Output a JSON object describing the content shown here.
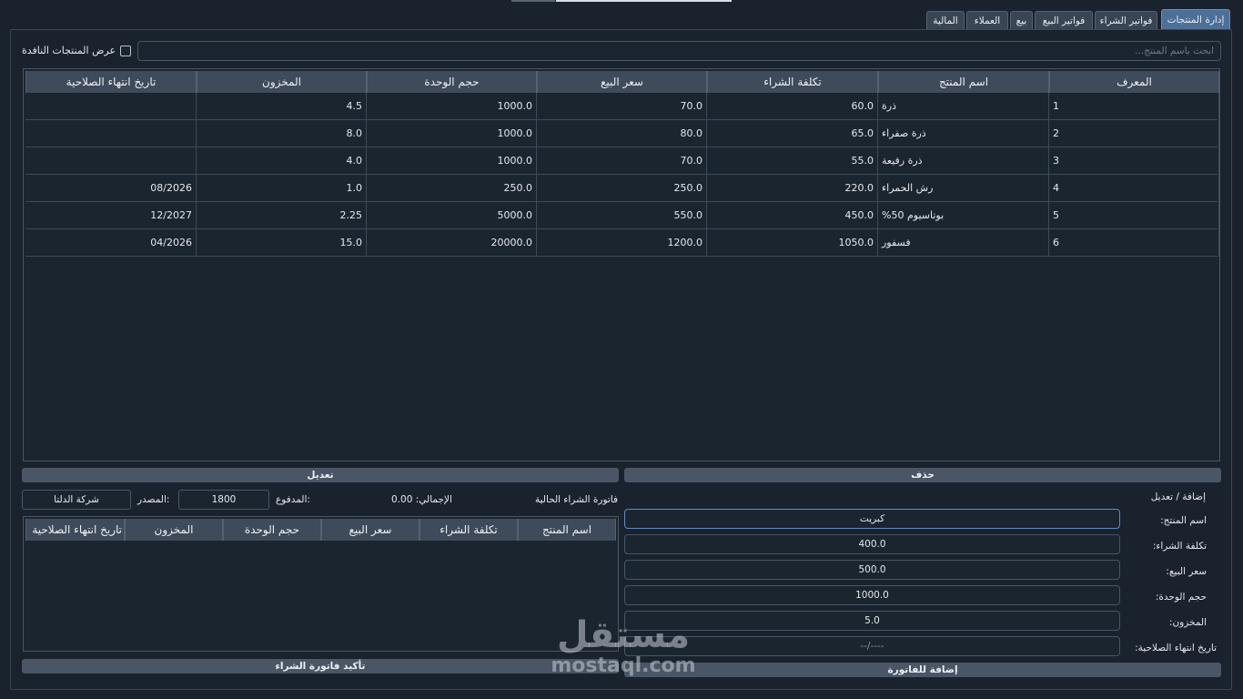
{
  "tabs": [
    {
      "label": "إدارة المنتجات",
      "active": true
    },
    {
      "label": "فواتير الشراء",
      "active": false
    },
    {
      "label": "فواتير البيع",
      "active": false
    },
    {
      "label": "بيع",
      "active": false
    },
    {
      "label": "العملاء",
      "active": false
    },
    {
      "label": "المالية",
      "active": false
    }
  ],
  "search": {
    "placeholder": "ابحث باسم المنتج..."
  },
  "expired_filter": {
    "label": "عرض المنتجات النافدة",
    "checked": false
  },
  "products_table": {
    "headers": [
      "المعرف",
      "اسم المنتج",
      "تكلفة الشراء",
      "سعر البيع",
      "حجم الوحدة",
      "المخزون",
      "تاريخ انتهاء الصلاحية"
    ],
    "rows": [
      {
        "id": "1",
        "name": "ذرة",
        "cost": "60.0",
        "price": "70.0",
        "unit": "1000.0",
        "stock": "4.5",
        "expiry": ""
      },
      {
        "id": "2",
        "name": "ذرة صفراء",
        "cost": "65.0",
        "price": "80.0",
        "unit": "1000.0",
        "stock": "8.0",
        "expiry": ""
      },
      {
        "id": "3",
        "name": "ذرة رفيعة",
        "cost": "55.0",
        "price": "70.0",
        "unit": "1000.0",
        "stock": "4.0",
        "expiry": ""
      },
      {
        "id": "4",
        "name": "رش الحمراء",
        "cost": "220.0",
        "price": "250.0",
        "unit": "250.0",
        "stock": "1.0",
        "expiry": "08/2026"
      },
      {
        "id": "5",
        "name": "بوتاسيوم 50%",
        "cost": "450.0",
        "price": "550.0",
        "unit": "5000.0",
        "stock": "2.25",
        "expiry": "12/2027"
      },
      {
        "id": "6",
        "name": "فسفور",
        "cost": "1050.0",
        "price": "1200.0",
        "unit": "20000.0",
        "stock": "15.0",
        "expiry": "04/2026"
      }
    ]
  },
  "actions": {
    "edit_label": "تعديل",
    "delete_label": "حذف"
  },
  "invoice": {
    "title": "فاتورة الشراء الحالية",
    "total_label": "الإجمالي: 0.00",
    "paid_label": "المدفوع:",
    "paid_value": "1800",
    "source_label": "المصدر:",
    "source_value": "شركة الدلتا",
    "headers": [
      "اسم المنتج",
      "تكلفة الشراء",
      "سعر البيع",
      "حجم الوحدة",
      "المخزون",
      "تاريخ انتهاء الصلاحية"
    ],
    "confirm_label": "تأكيد فاتورة الشراء"
  },
  "form": {
    "title": "إضافة / تعديل",
    "name_label": "اسم المنتج:",
    "name_value": "كبريت",
    "cost_label": "تكلفة الشراء:",
    "cost_value": "400.0",
    "price_label": "سعر البيع:",
    "price_value": "500.0",
    "unit_label": "حجم الوحدة:",
    "unit_value": "1000.0",
    "stock_label": "المخزون:",
    "stock_value": "5.0",
    "expiry_label": "تاريخ انتهاء الصلاحية:",
    "expiry_value": "--/----",
    "add_label": "إضافة للفاتورة"
  },
  "watermark": {
    "arabic": "مستقل",
    "latin": "mostaql.com"
  },
  "colors": {
    "background": "#19222d",
    "header": "#3f4a5a",
    "button": "#4a5565",
    "active_tab": "#4d6f98"
  }
}
